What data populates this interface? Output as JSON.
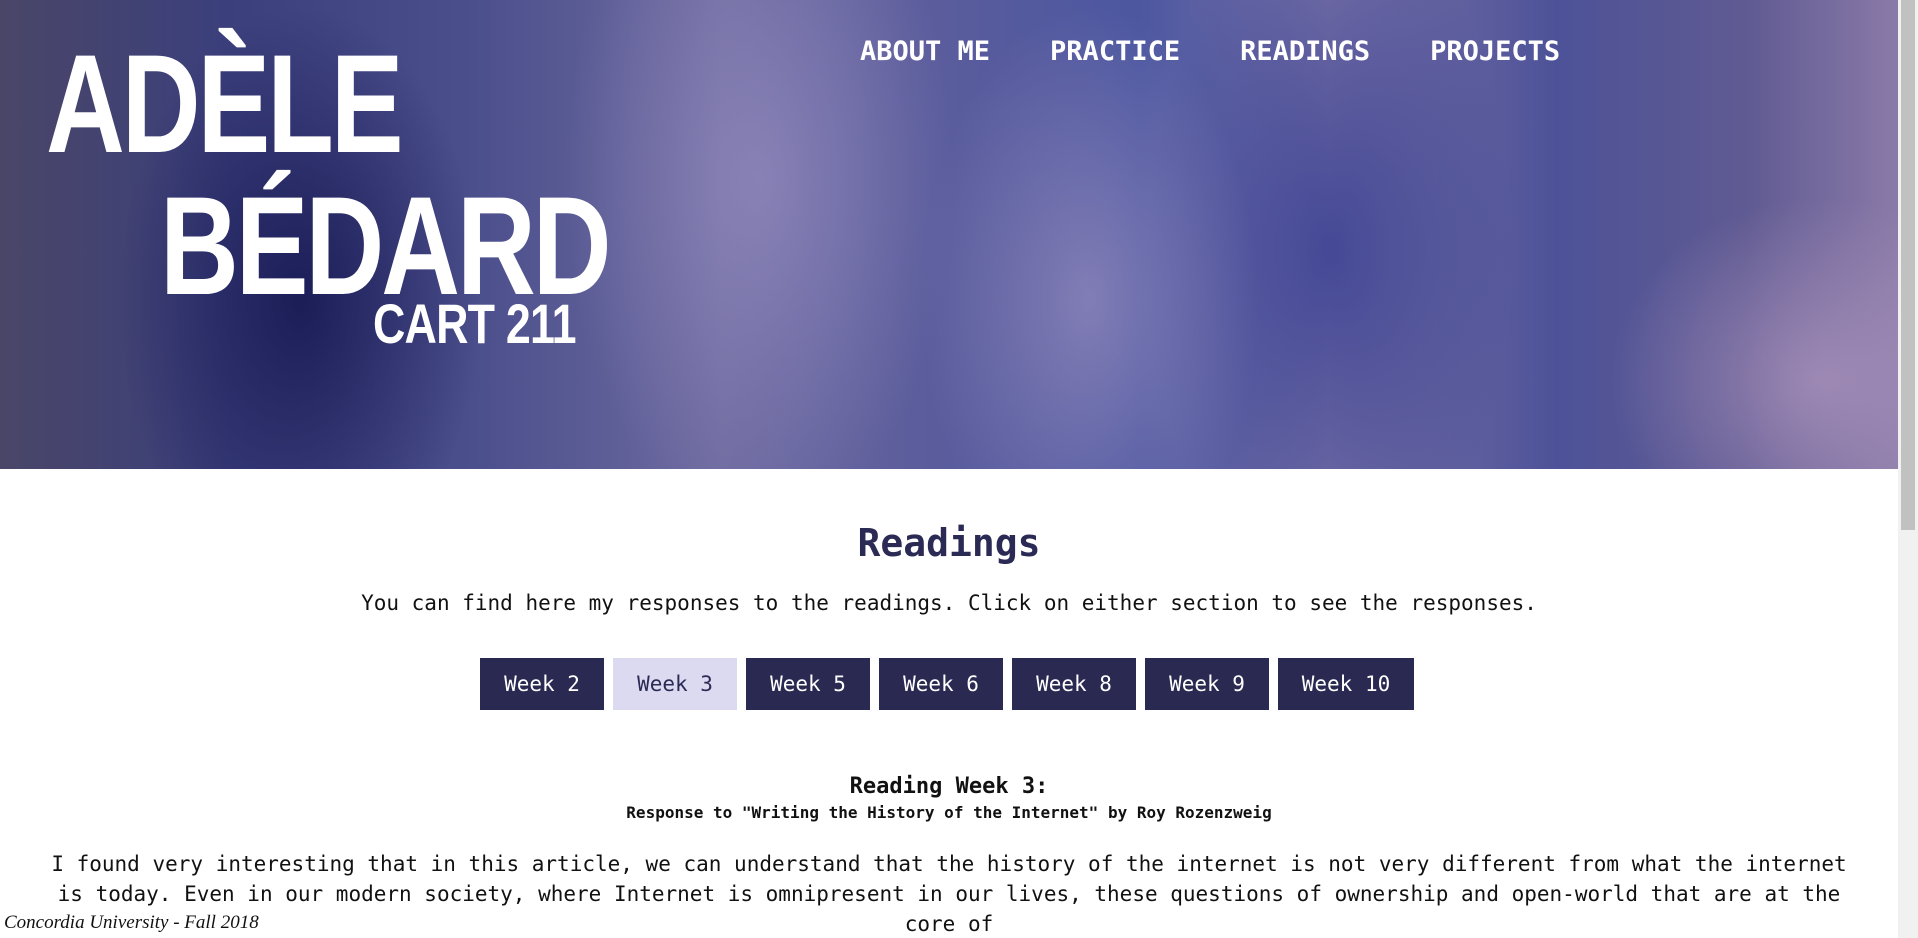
{
  "header": {
    "name_line1": "ADÈLE",
    "name_line2": "BÉDARD",
    "course": "CART 211"
  },
  "nav": {
    "items": [
      {
        "label": "ABOUT ME"
      },
      {
        "label": "PRACTICE"
      },
      {
        "label": "READINGS"
      },
      {
        "label": "PROJECTS"
      }
    ]
  },
  "main": {
    "heading": "Readings",
    "intro": "You can find here my responses to the readings. Click on either section to see the responses.",
    "weeks": [
      {
        "label": "Week 2",
        "active": false
      },
      {
        "label": "Week 3",
        "active": true
      },
      {
        "label": "Week 5",
        "active": false
      },
      {
        "label": "Week 6",
        "active": false
      },
      {
        "label": "Week 8",
        "active": false
      },
      {
        "label": "Week 9",
        "active": false
      },
      {
        "label": "Week 10",
        "active": false
      }
    ],
    "reading_title": "Reading Week 3:",
    "reading_subtitle": "Response to \"Writing the History of the Internet\" by Roy Rozenzweig",
    "reading_body": "I found very interesting that in this article, we can understand that the history of the internet is not very different from what the internet is today. Even in our modern society, where Internet is omnipresent in our lives, these questions of ownership and open-world that are at the core of"
  },
  "footer": {
    "text": "Concordia University - Fall 2018"
  },
  "colors": {
    "accent": "#2a2952",
    "active_tab": "#dcdaf0",
    "heading": "#2b2a55"
  }
}
